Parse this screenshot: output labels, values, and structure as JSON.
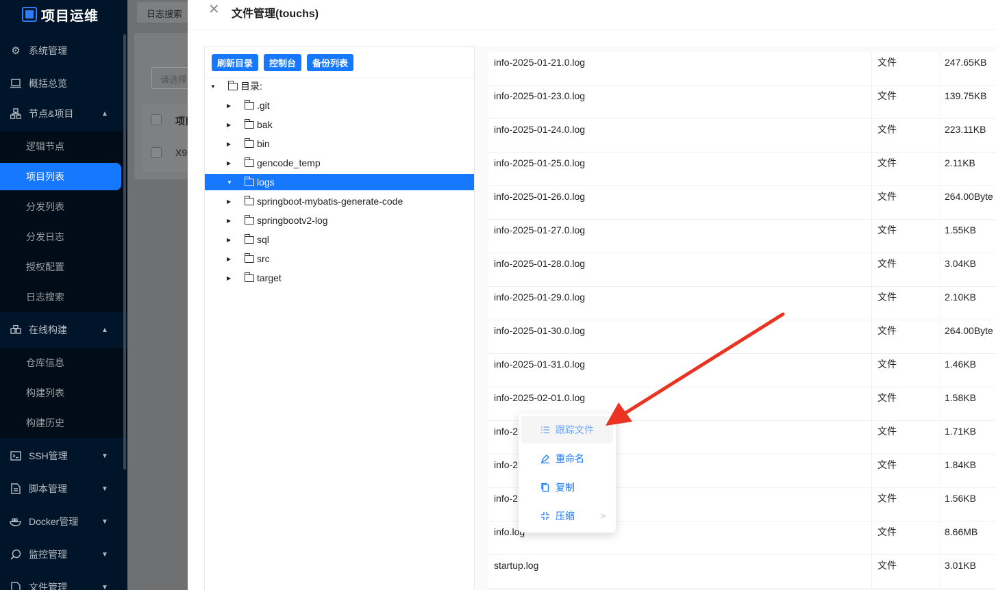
{
  "app": {
    "title": "项目运维"
  },
  "sidebar": {
    "items": [
      {
        "label": "系统管理",
        "icon": "gear-icon"
      },
      {
        "label": "概括总览",
        "icon": "laptop-icon"
      },
      {
        "label": "节点&项目",
        "icon": "cluster-icon",
        "expanded": true,
        "children": [
          "逻辑节点",
          "项目列表",
          "分发列表",
          "分发日志",
          "授权配置",
          "日志搜索"
        ]
      },
      {
        "label": "在线构建",
        "icon": "build-icon",
        "expanded": true,
        "children": [
          "仓库信息",
          "构建列表",
          "构建历史"
        ]
      },
      {
        "label": "SSH管理",
        "icon": "terminal-icon"
      },
      {
        "label": "脚本管理",
        "icon": "script-icon"
      },
      {
        "label": "Docker管理",
        "icon": "docker-icon"
      },
      {
        "label": "监控管理",
        "icon": "monitor-icon"
      },
      {
        "label": "文件管理",
        "icon": "file-icon"
      }
    ],
    "active_child": "项目列表"
  },
  "background_page": {
    "tab_label": "日志搜索",
    "select_placeholder": "请选择",
    "table_header": "项目",
    "table_cell": "X9"
  },
  "drawer": {
    "title": "文件管理(touchs)",
    "toolbar": {
      "refresh": "刷新目录",
      "console": "控制台",
      "backup": "备份列表"
    },
    "tree": {
      "root": "目录:",
      "nodes": [
        ".git",
        "bak",
        "bin",
        "gencode_temp",
        "logs",
        "springboot-mybatis-generate-code",
        "springbootv2-log",
        "sql",
        "src",
        "target"
      ],
      "selected": "logs"
    },
    "files": [
      {
        "name": "info-2025-01-21.0.log",
        "type": "文件",
        "size": "247.65KB"
      },
      {
        "name": "info-2025-01-23.0.log",
        "type": "文件",
        "size": "139.75KB"
      },
      {
        "name": "info-2025-01-24.0.log",
        "type": "文件",
        "size": "223.11KB"
      },
      {
        "name": "info-2025-01-25.0.log",
        "type": "文件",
        "size": "2.11KB"
      },
      {
        "name": "info-2025-01-26.0.log",
        "type": "文件",
        "size": "264.00Byte"
      },
      {
        "name": "info-2025-01-27.0.log",
        "type": "文件",
        "size": "1.55KB"
      },
      {
        "name": "info-2025-01-28.0.log",
        "type": "文件",
        "size": "3.04KB"
      },
      {
        "name": "info-2025-01-29.0.log",
        "type": "文件",
        "size": "2.10KB"
      },
      {
        "name": "info-2025-01-30.0.log",
        "type": "文件",
        "size": "264.00Byte"
      },
      {
        "name": "info-2025-01-31.0.log",
        "type": "文件",
        "size": "1.46KB"
      },
      {
        "name": "info-2025-02-01.0.log",
        "type": "文件",
        "size": "1.58KB"
      },
      {
        "name": "info-2",
        "type": "文件",
        "size": "1.71KB"
      },
      {
        "name": "info-2",
        "type": "文件",
        "size": "1.84KB"
      },
      {
        "name": "info-2",
        "type": "文件",
        "size": "1.56KB"
      },
      {
        "name": "info.log",
        "type": "文件",
        "size": "8.66MB"
      },
      {
        "name": "startup.log",
        "type": "文件",
        "size": "3.01KB"
      }
    ]
  },
  "context_menu": {
    "items": [
      {
        "label": "跟踪文件",
        "icon": "list-icon"
      },
      {
        "label": "重命名",
        "icon": "highlight-icon"
      },
      {
        "label": "复制",
        "icon": "copy-icon"
      },
      {
        "label": "压缩",
        "icon": "compress-icon",
        "has_submenu": true
      }
    ]
  },
  "colors": {
    "primary": "#1677ff",
    "sidebar_bg": "#001529",
    "annotation_arrow": "#ea3323"
  }
}
